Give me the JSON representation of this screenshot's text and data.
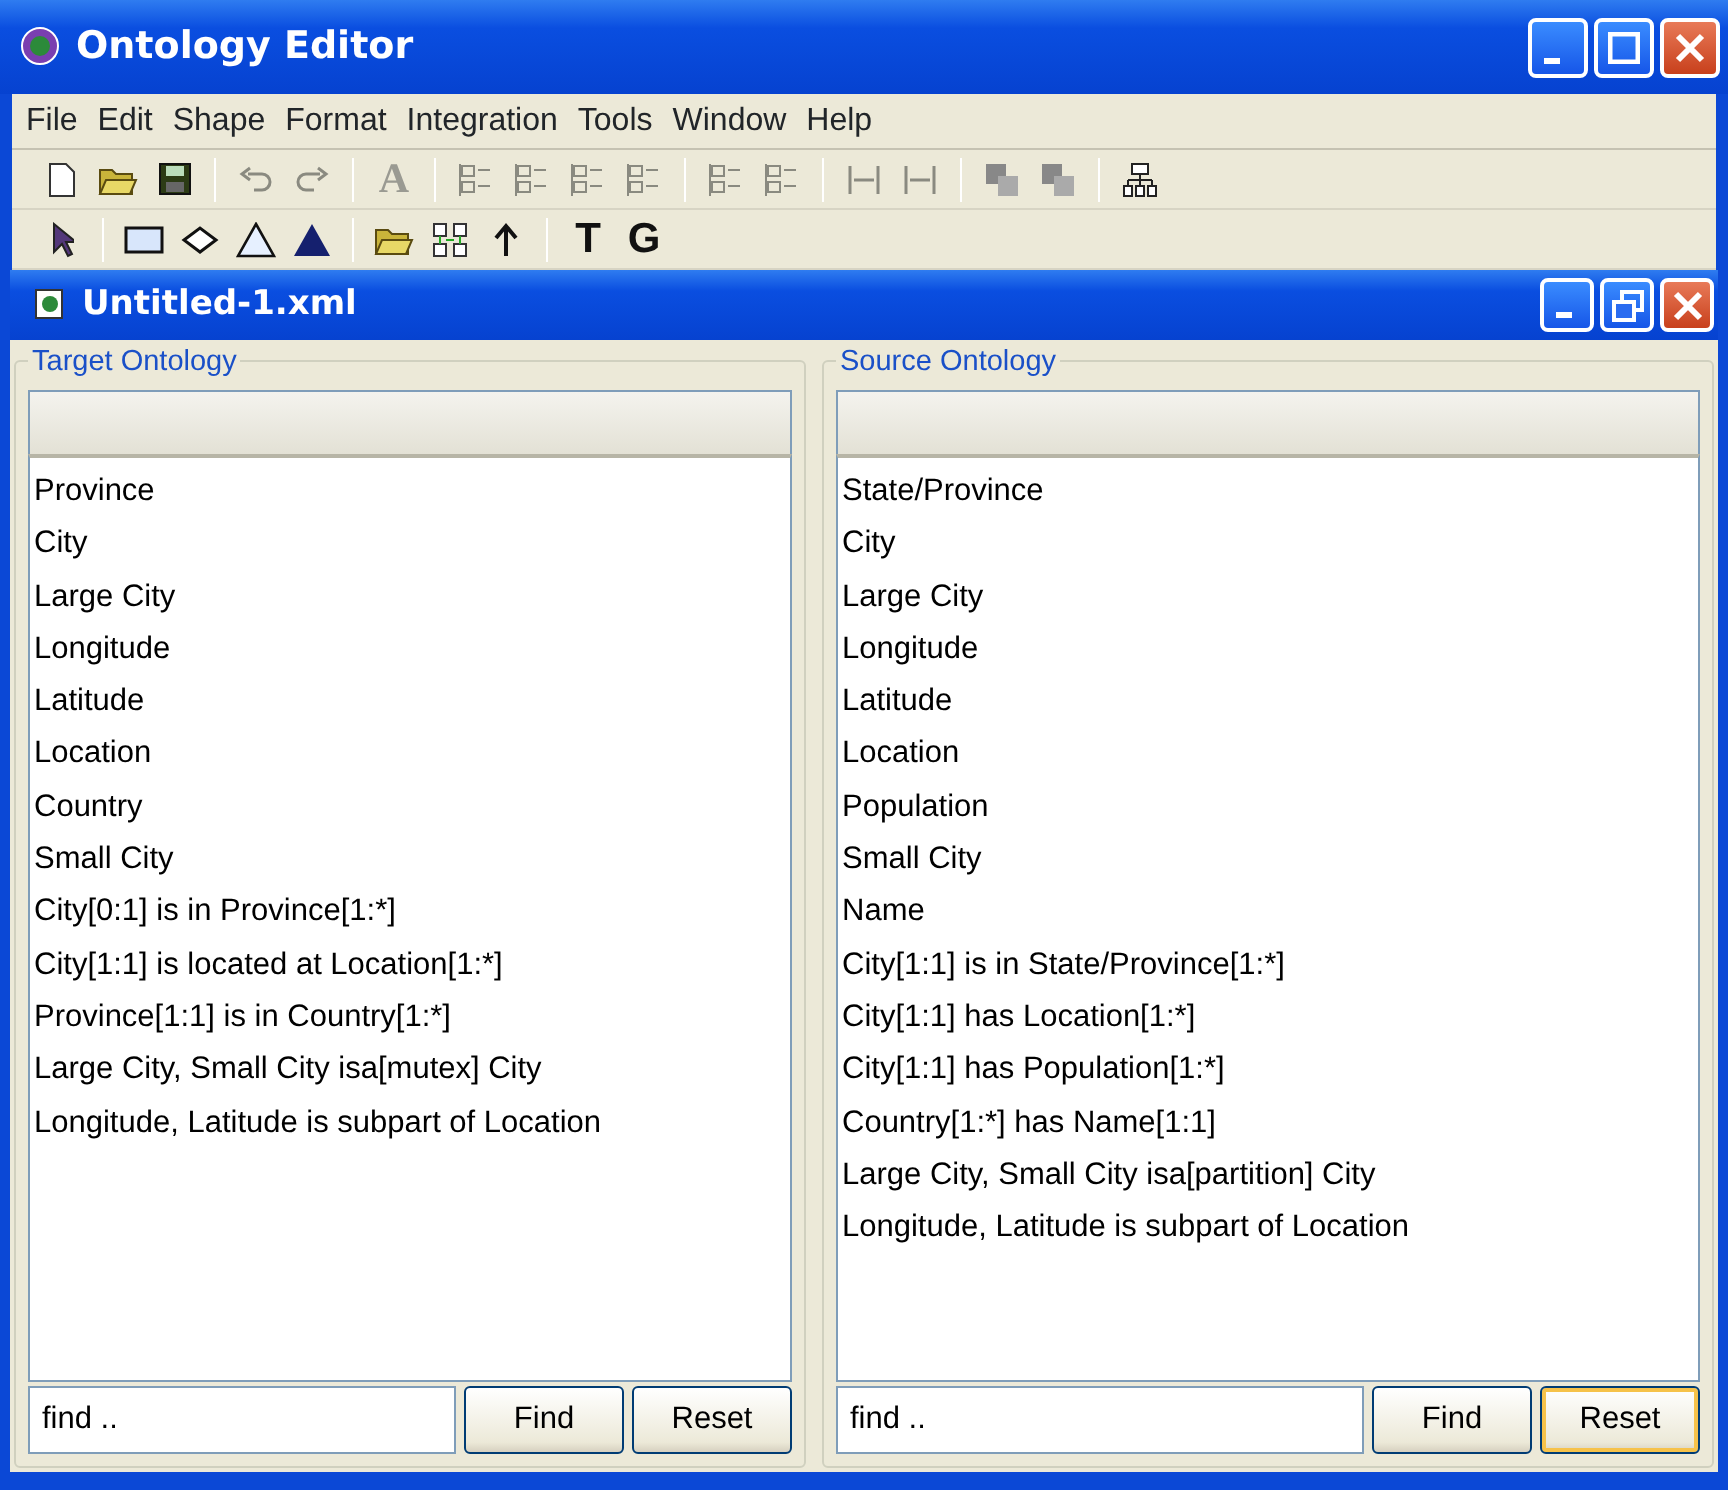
{
  "window": {
    "title": "Ontology Editor"
  },
  "menu": [
    {
      "label": "File"
    },
    {
      "label": "Edit"
    },
    {
      "label": "Shape"
    },
    {
      "label": "Format"
    },
    {
      "label": "Integration"
    },
    {
      "label": "Tools"
    },
    {
      "label": "Window"
    },
    {
      "label": "Help"
    }
  ],
  "toolbar_text_buttons": [
    {
      "label": "A",
      "disabled": true
    },
    {
      "label": "T",
      "disabled": false
    },
    {
      "label": "G",
      "disabled": false
    }
  ],
  "document": {
    "title": "Untitled-1.xml"
  },
  "panels": [
    {
      "title": "Target Ontology",
      "items": [
        "Province",
        "City",
        "Large City",
        "Longitude",
        "Latitude",
        "Location",
        "Country",
        "Small City",
        "City[0:1] is in Province[1:*]",
        "City[1:1] is located at Location[1:*]",
        "Province[1:1] is in Country[1:*]",
        "Large City, Small City isa[mutex] City",
        "Longitude, Latitude is subpart of Location"
      ],
      "search": {
        "value": "find .."
      },
      "buttons": [
        {
          "label": "Find",
          "hovered": false
        },
        {
          "label": "Reset",
          "hovered": false
        }
      ]
    },
    {
      "title": "Source Ontology",
      "items": [
        "State/Province",
        "City",
        "Large City",
        "Longitude",
        "Latitude",
        "Location",
        "Population",
        "Small City",
        "Name",
        "City[1:1] is in State/Province[1:*]",
        "City[1:1] has Location[1:*]",
        "City[1:1] has Population[1:*]",
        "Country[1:*] has Name[1:1]",
        "Large City, Small City isa[partition] City",
        "Longitude, Latitude is subpart of Location"
      ],
      "search": {
        "value": "find .."
      },
      "buttons": [
        {
          "label": "Find",
          "hovered": false
        },
        {
          "label": "Reset",
          "hovered": true
        }
      ]
    }
  ]
}
